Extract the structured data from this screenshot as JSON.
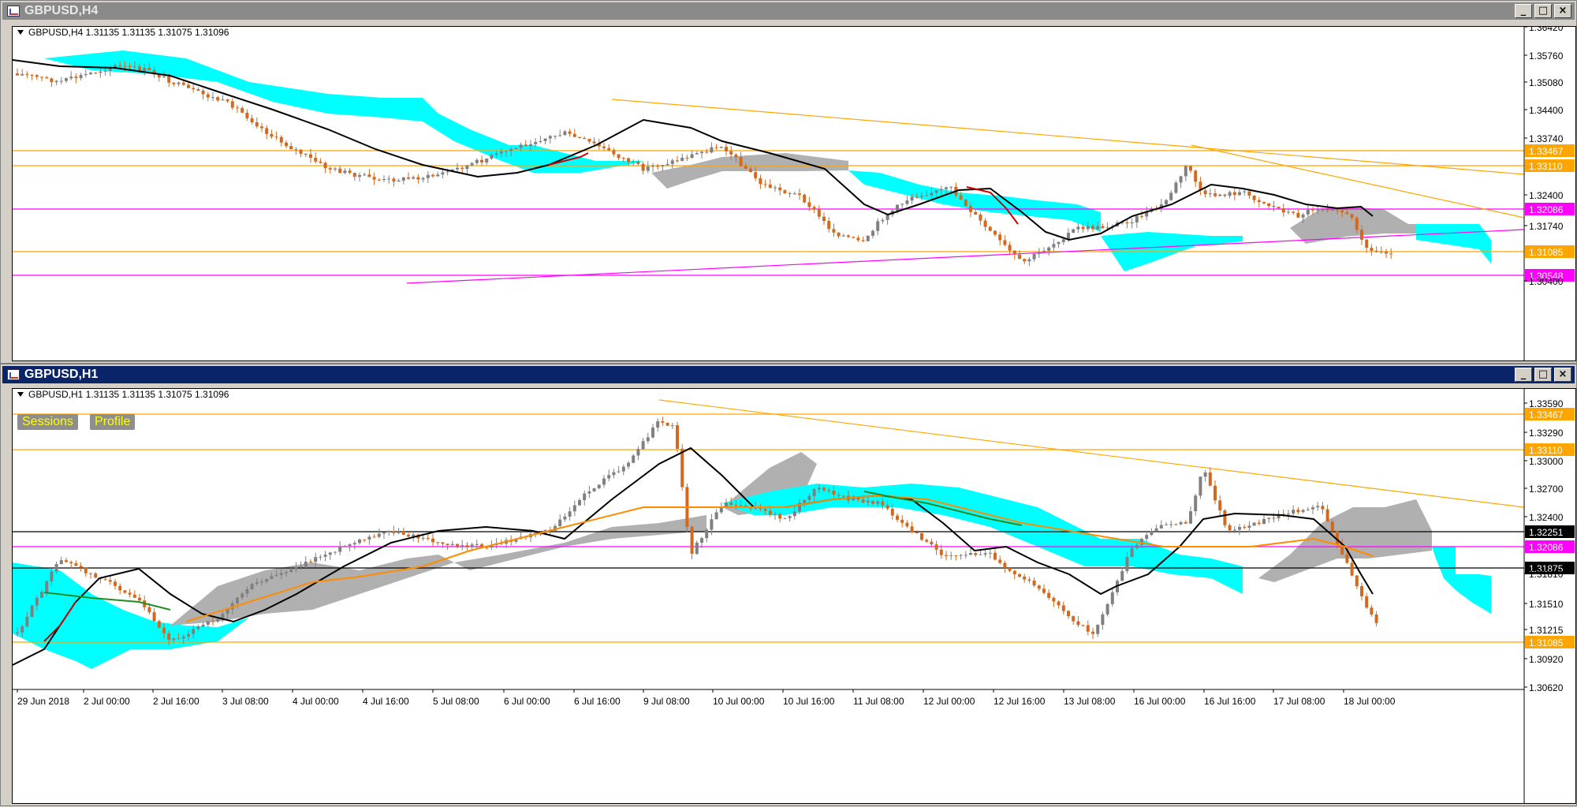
{
  "windows": [
    {
      "title": "GBPUSD,H4",
      "info": "GBPUSD,H4  1.31135 1.31135 1.31075 1.31096",
      "price_axis": [
        "1.36420",
        "1.35760",
        "1.35080",
        "1.34400",
        "1.33740",
        "1.33467",
        "1.33110",
        "1.32400",
        "1.32086",
        "1.31740",
        "1.31085",
        "1.30548",
        "1.30400"
      ],
      "hlines": [
        {
          "label": "1.33467",
          "color": "#ffa500",
          "text_color": "#ffffff"
        },
        {
          "label": "1.33110",
          "color": "#ffa500",
          "text_color": "#ffffff"
        },
        {
          "label": "1.32086",
          "color": "#ff00ff",
          "text_color": "#ffffff"
        },
        {
          "label": "1.31085",
          "color": "#ffa500",
          "text_color": "#ffffff"
        },
        {
          "label": "1.30548",
          "color": "#ff00ff",
          "text_color": "#ffffff"
        }
      ]
    },
    {
      "title": "GBPUSD,H1",
      "info": "GBPUSD,H1  1.31135 1.31135 1.31075 1.31096",
      "buttons": {
        "sessions": "Sessions",
        "profile": "Profile"
      },
      "price_axis": [
        "1.33590",
        "1.33467",
        "1.33290",
        "1.33110",
        "1.33000",
        "1.32700",
        "1.32400",
        "1.32251",
        "1.32086",
        "1.31875",
        "1.31810",
        "1.31510",
        "1.31215",
        "1.31085",
        "1.30920",
        "1.30620"
      ],
      "hlines": [
        {
          "label": "1.33467",
          "color": "#ffa500",
          "text_color": "#ffffff"
        },
        {
          "label": "1.33110",
          "color": "#ffa500",
          "text_color": "#ffffff"
        },
        {
          "label": "1.32251",
          "color": "#000000",
          "text_color": "#ffffff"
        },
        {
          "label": "1.32086",
          "color": "#ff00ff",
          "text_color": "#ffffff"
        },
        {
          "label": "1.31875",
          "color": "#000000",
          "text_color": "#ffffff"
        },
        {
          "label": "1.31085",
          "color": "#ffa500",
          "text_color": "#ffffff"
        }
      ],
      "time_axis": [
        "29 Jun 2018",
        "2 Jul 00:00",
        "2 Jul 16:00",
        "3 Jul 08:00",
        "4 Jul 00:00",
        "4 Jul 16:00",
        "5 Jul 08:00",
        "6 Jul 00:00",
        "6 Jul 16:00",
        "9 Jul 08:00",
        "10 Jul 00:00",
        "10 Jul 16:00",
        "11 Jul 08:00",
        "12 Jul 00:00",
        "12 Jul 16:00",
        "13 Jul 08:00",
        "16 Jul 00:00",
        "16 Jul 16:00",
        "17 Jul 08:00",
        "18 Jul 00:00"
      ]
    }
  ],
  "colors": {
    "bull": "#808080",
    "bear": "#d2691e",
    "cloud_bull": "#00ffff",
    "cloud_bear": "#b0b0b0",
    "ma": "#000000",
    "ma2": "#ff8c00"
  }
}
